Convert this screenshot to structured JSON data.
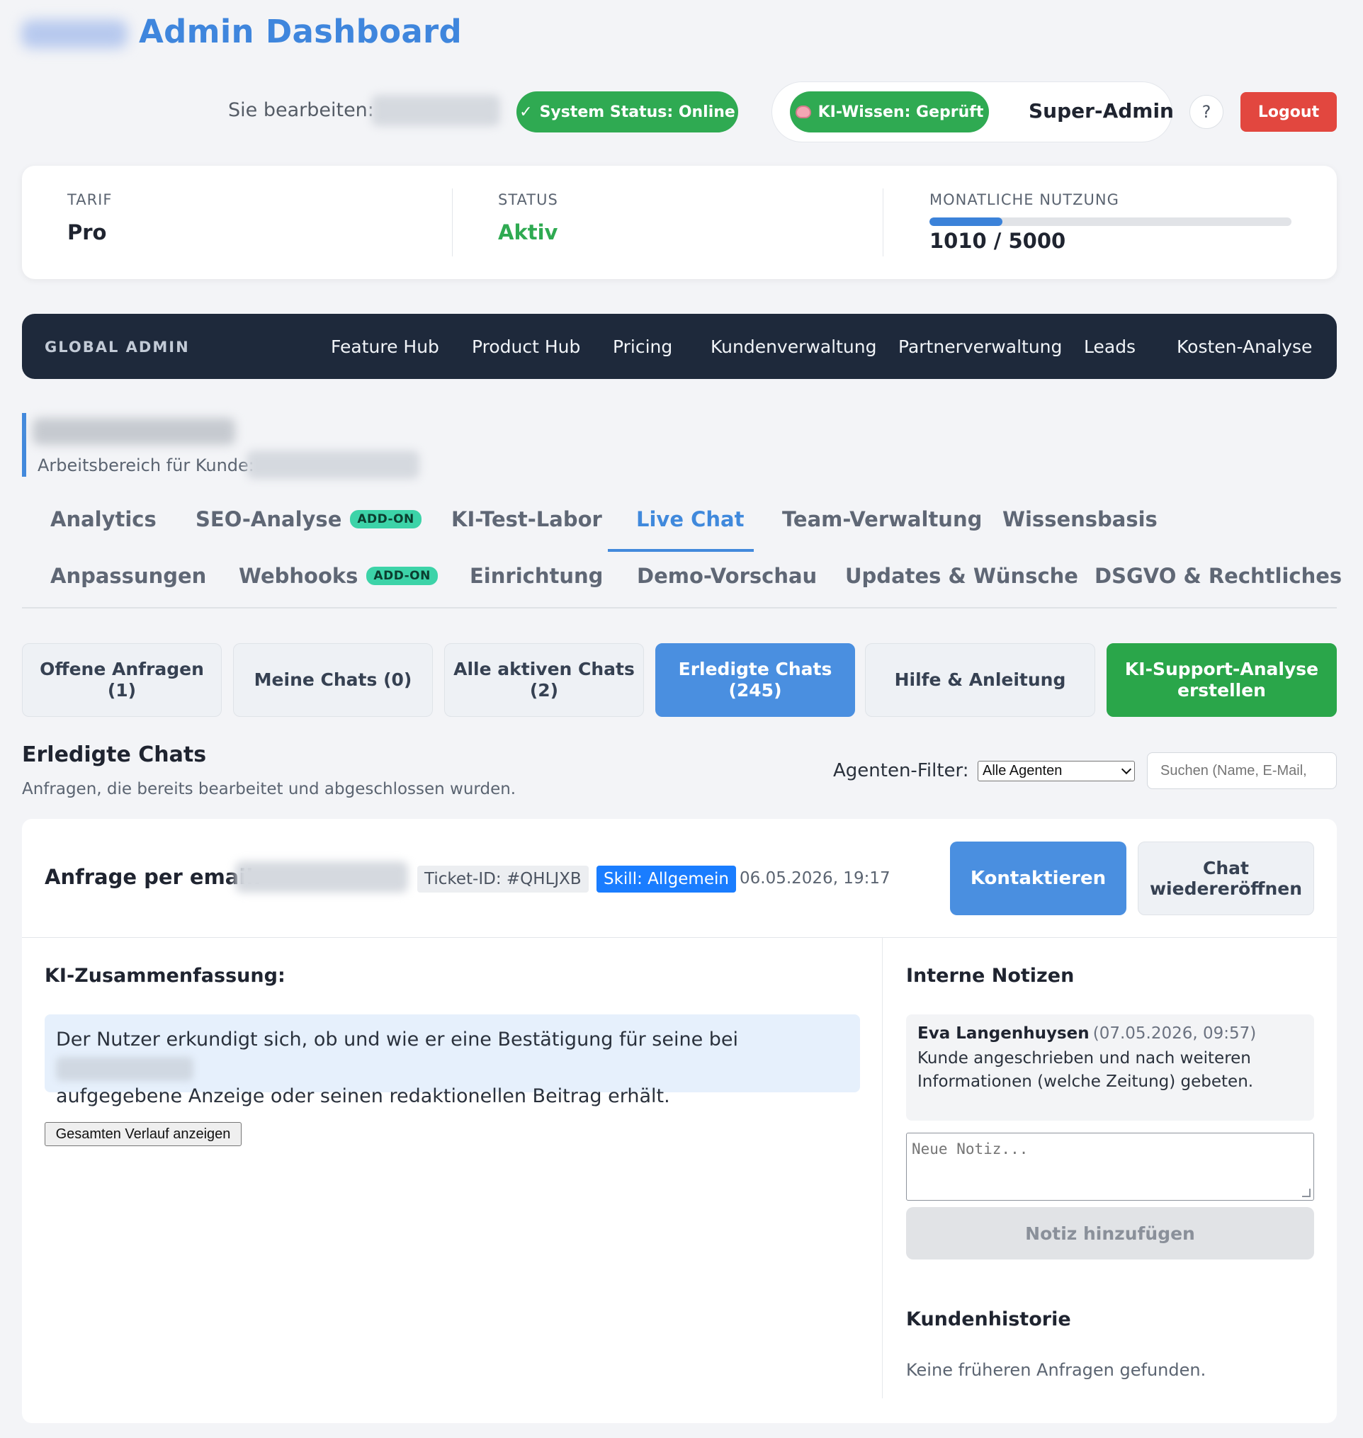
{
  "header": {
    "title": "Admin Dashboard",
    "editing_label": "Sie bearbeiten:",
    "system_status": "System Status: Online",
    "ki_wissen": "KI-Wissen: Geprüft",
    "role": "Super-Admin",
    "help_label": "?",
    "logout_label": "Logout"
  },
  "summary": {
    "plan_label": "TARIF",
    "plan_value": "Pro",
    "status_label": "STATUS",
    "status_value": "Aktiv",
    "usage_label": "MONATLICHE NUTZUNG",
    "usage_text": "1010 / 5000",
    "usage_used": 1010,
    "usage_limit": 5000
  },
  "admin_nav": {
    "label": "GLOBAL ADMIN",
    "links": [
      "Feature Hub",
      "Product Hub",
      "Pricing",
      "Kundenverwaltung",
      "Partnerverwaltung",
      "Leads",
      "Kosten-Analyse"
    ]
  },
  "workspace": {
    "client_label": "Arbeitsbereich für Kunde:"
  },
  "tabs": {
    "addon_label": "ADD-ON",
    "row1": [
      "Analytics",
      "SEO-Analyse",
      "KI-Test-Labor",
      "Live Chat",
      "Team-Verwaltung",
      "Wissensbasis"
    ],
    "row2": [
      "Anpassungen",
      "Webhooks",
      "Einrichtung",
      "Demo-Vorschau",
      "Updates & Wünsche",
      "DSGVO & Rechtliches"
    ],
    "active": "Live Chat"
  },
  "filters": [
    {
      "line1": "Offene Anfragen",
      "line2": "(1)"
    },
    {
      "line1": "Meine Chats (0)",
      "line2": ""
    },
    {
      "line1": "Alle aktiven Chats",
      "line2": "(2)"
    },
    {
      "line1": "Erledigte Chats",
      "line2": "(245)"
    },
    {
      "line1": "Hilfe & Anleitung",
      "line2": ""
    },
    {
      "line1": "KI-Support-Analyse",
      "line2": "erstellen"
    }
  ],
  "section": {
    "title": "Erledigte Chats",
    "subtitle": "Anfragen, die bereits bearbeitet und abgeschlossen wurden.",
    "agent_filter_label": "Agenten-Filter:",
    "agent_filter_value": "Alle Agenten",
    "search_placeholder": "Suchen (Name, E-Mail,"
  },
  "ticket": {
    "request_label": "Anfrage per email:",
    "ticket_id": "Ticket-ID: #QHLJXB",
    "skill": "Skill: Allgemein",
    "date": "06.05.2026, 19:17",
    "contact_label": "Kontaktieren",
    "reopen_line1": "Chat",
    "reopen_line2": "wiedereröffnen",
    "summary_heading": "KI-Zusammenfassung:",
    "summary_part1": "Der Nutzer erkundigt sich, ob und wie er eine Bestätigung für seine bei",
    "summary_part2": "aufgegebene Anzeige oder seinen redaktionellen Beitrag erhält.",
    "history_button": "Gesamten Verlauf anzeigen",
    "notes_heading": "Interne Notizen",
    "note": {
      "author": "Eva Langenhuysen",
      "time": "(07.05.2026, 09:57)",
      "text": "Kunde angeschrieben und nach weiteren Informationen (welche Zeitung) gebeten."
    },
    "note_placeholder": "Neue Notiz...",
    "add_note_label": "Notiz hinzufügen",
    "history_heading": "Kundenhistorie",
    "history_empty": "Keine früheren Anfragen gefunden."
  },
  "colors": {
    "accent": "#4289dc",
    "success": "#2faa52",
    "danger": "#e2473f",
    "nav_dark": "#1e293b"
  }
}
